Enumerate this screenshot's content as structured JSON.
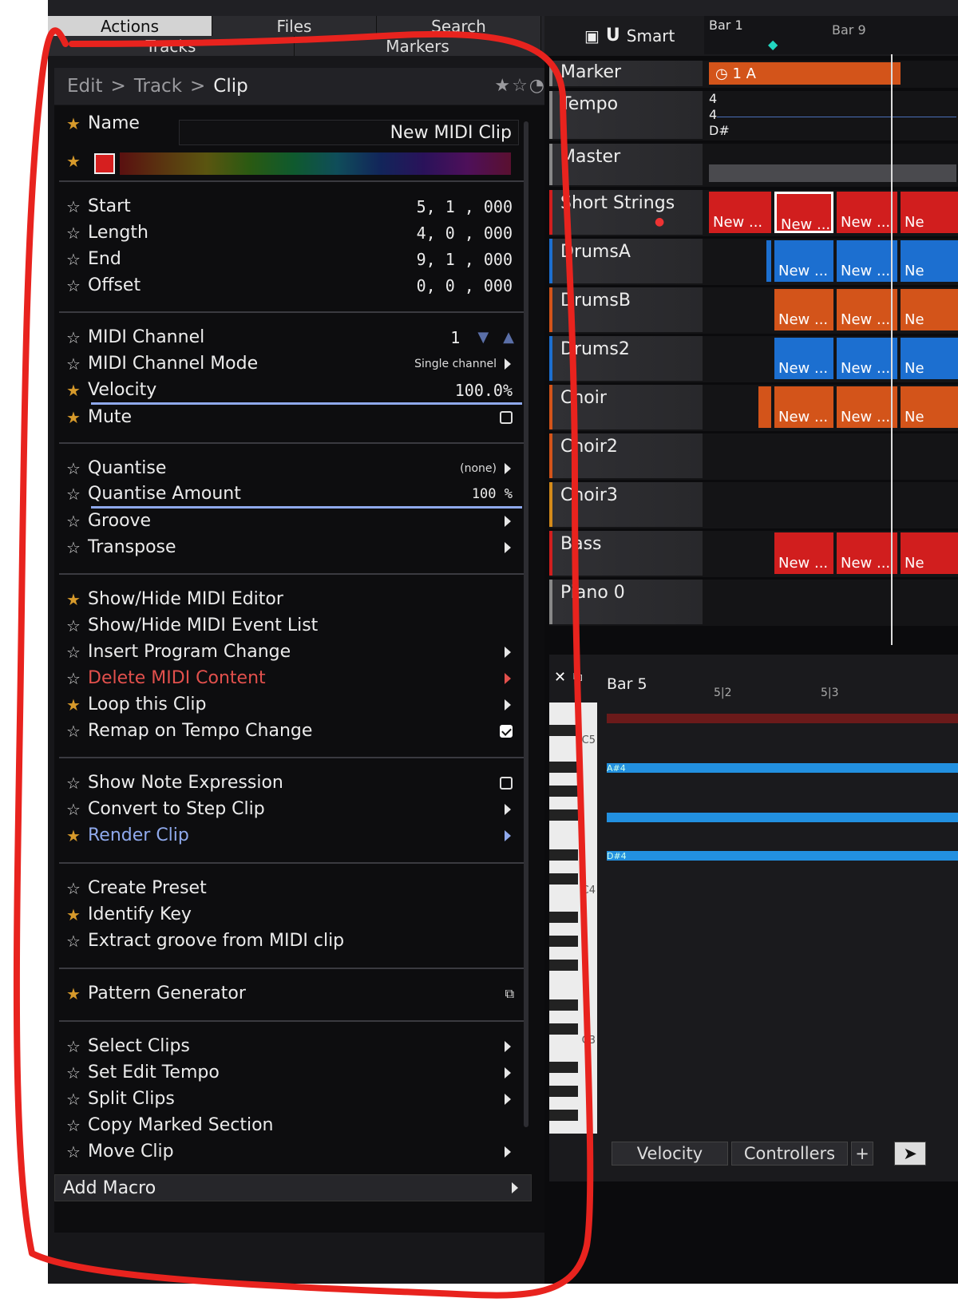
{
  "tabs": {
    "row1": [
      "Actions",
      "Files",
      "Search"
    ],
    "row2": [
      "Tracks",
      "Markers"
    ],
    "close": "✕",
    "add": "✚"
  },
  "breadcrumb": {
    "a": "Edit",
    "b": "Track",
    "c": "Clip",
    "sep": ">"
  },
  "clip": {
    "name_label": "Name",
    "name_value": "New MIDI Clip",
    "swatch_color": "#d61f1f"
  },
  "timing": [
    {
      "label": "Start",
      "value": "5, 1 , 000",
      "fav": false
    },
    {
      "label": "Length",
      "value": "4, 0 , 000",
      "fav": false
    },
    {
      "label": "End",
      "value": "9, 1 , 000",
      "fav": false
    },
    {
      "label": "Offset",
      "value": "0, 0 , 000",
      "fav": false
    }
  ],
  "midi": {
    "channel_label": "MIDI Channel",
    "channel_value": "1",
    "mode_label": "MIDI Channel Mode",
    "mode_value": "Single channel",
    "velocity_label": "Velocity",
    "velocity_value": "100.0%",
    "velocity_fraction": 1.0,
    "mute_label": "Mute"
  },
  "quantise": {
    "quantise_label": "Quantise",
    "quantise_value": "(none)",
    "amount_label": "Quantise Amount",
    "amount_value": "100 %",
    "amount_fraction": 1.0,
    "groove_label": "Groove",
    "transpose_label": "Transpose"
  },
  "actions1": [
    "Show/Hide MIDI Editor",
    "Show/Hide MIDI Event List",
    "Insert Program Change",
    "Delete MIDI Content",
    "Loop this Clip",
    "Remap on Tempo Change"
  ],
  "actions2": [
    "Show Note Expression",
    "Convert to Step Clip",
    "Render Clip"
  ],
  "actions3": [
    "Create Preset",
    "Identify Key",
    "Extract groove from MIDI clip"
  ],
  "actions4": [
    "Pattern Generator"
  ],
  "actions5": [
    "Select Clips",
    "Set Edit Tempo",
    "Split Clips",
    "Copy Marked Section",
    "Move Clip"
  ],
  "add_macro": "Add Macro",
  "arranger": {
    "smart_label": "Smart",
    "bar1": "Bar 1",
    "bar9": "Bar 9",
    "marker_text": "1 A",
    "tempo_sig_top": "4",
    "tempo_sig_bottom": "4",
    "tempo_key": "D#",
    "tracks": [
      "Marker",
      "Tempo",
      "Master",
      "Short Strings",
      "DrumsA",
      "DrumsB",
      "Drums2",
      "Choir",
      "Choir2",
      "Choir3",
      "Bass",
      "Piano 0"
    ],
    "clip_label": "New ...",
    "clip_label_short": "Ne"
  },
  "pianoroll": {
    "bar5": "Bar 5",
    "t1": "5|2",
    "t2": "5|3",
    "c5": "C5",
    "c4": "C4",
    "c3": "C3",
    "n1": "A#4",
    "n2": "D#4",
    "velocity_tab": "Velocity",
    "controllers_tab": "Controllers",
    "plus": "+"
  },
  "colors": {
    "fav_star": "#d79a2b",
    "accent_blue": "#8fa9ec",
    "danger": "#e2504c",
    "annotation": "#e8231e"
  }
}
